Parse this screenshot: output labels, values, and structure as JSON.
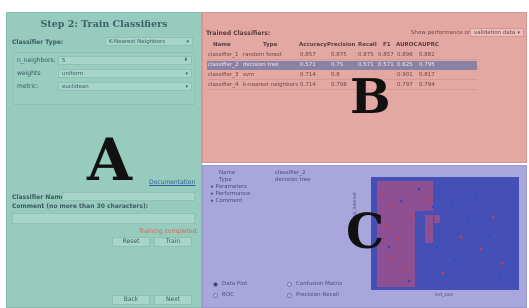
{
  "panel_a": {
    "title": "Step 2: Train Classifiers",
    "classifier_type_label": "Classifier Type:",
    "classifier_type_value": "K-Nearest Neighbors",
    "params": [
      {
        "label": "n_neighbors:",
        "value": "5"
      },
      {
        "label": "weights:",
        "value": "uniform"
      },
      {
        "label": "metric:",
        "value": "euclidean"
      }
    ],
    "overlay_letter": "A",
    "documentation_link": "Documentation",
    "classifier_name_label": "Classifier Name:",
    "comment_label": "Comment (no more than 30 characters):",
    "status": "Training completed.",
    "reset_label": "Reset",
    "train_label": "Train",
    "back_label": "Back",
    "next_label": "Next"
  },
  "panel_b": {
    "title": "Trained Classifiers:",
    "show_perf_label": "Show performance on",
    "show_perf_value": "validation data",
    "columns": [
      "Name",
      "Type",
      "Accuracy",
      "Precision",
      "Recall",
      "F1",
      "AUROC",
      "AUPRC"
    ],
    "rows": [
      [
        "classifier_1",
        "random forest",
        "0.857",
        "0.875",
        "0.875",
        "0.857",
        "0.896",
        "0.882"
      ],
      [
        "classifier_2",
        "decision tree",
        "0.571",
        "0.75",
        "0.571",
        "0.571",
        "0.625",
        "0.795"
      ],
      [
        "classifier_3",
        "svm",
        "0.714",
        "0.8",
        "",
        "",
        "0.901",
        "0.817"
      ],
      [
        "classifier_4",
        "k-nearest neighbors",
        "0.714",
        "0.708",
        "",
        "",
        "0.797",
        "0.794"
      ]
    ],
    "overlay_letter": "B"
  },
  "panel_c": {
    "info": {
      "name_label": "Name",
      "name_value": "classifier_2",
      "type_label": "Type",
      "type_value": "decision tree",
      "expanders": [
        "Parameters",
        "Performance",
        "Comment"
      ]
    },
    "options": {
      "data_plot": "Data Plot",
      "confusion_matrix": "Confusion Matrix",
      "roc": "ROC",
      "precision_recall": "Precision-Recall"
    },
    "selected_option": "Data Plot",
    "xlabel": "ind_size",
    "ylabel": "total_interest",
    "overlay_letter": "C"
  },
  "colors": {
    "panel_a": "#96cbbd",
    "panel_b": "#e4a8a3",
    "panel_c": "#a9a6dc",
    "selected_row": "#8a82a4",
    "status": "#c96b5e",
    "plot_blue": "#4550b6",
    "plot_purple": "#8e4f93",
    "point_red": "#c0404a",
    "point_blue": "#3148c8"
  },
  "icons": {
    "dropdown": "chevron-down-icon",
    "spinner": "spinner-arrows-icon",
    "expander": "caret-right-icon",
    "radio": "radio-icon"
  }
}
